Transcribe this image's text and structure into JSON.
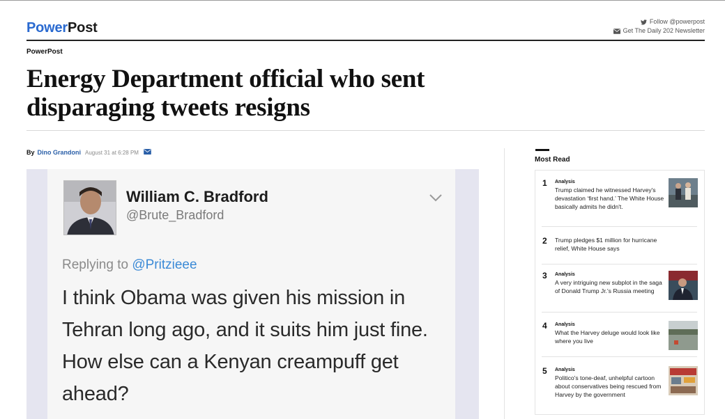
{
  "header": {
    "brand_part1": "Power",
    "brand_part2": "Post",
    "follow_label": "Follow @powerpost",
    "newsletter_label": "Get The Daily 202 Newsletter"
  },
  "kicker": "PowerPost",
  "headline": "Energy Department official who sent disparaging tweets resigns",
  "byline": {
    "by": "By",
    "author": "Dino Grandoni",
    "date": "August 31 at 6:28 PM"
  },
  "tweet": {
    "name": "William C. Bradford",
    "handle": "@Brute_Bradford",
    "replying_prefix": "Replying to ",
    "replying_to": "@Pritzieee",
    "text": "I think Obama was given his mission in Tehran long ago, and it suits him just fine. How else can a Kenyan creampuff get ahead?"
  },
  "most_read": {
    "title": "Most Read",
    "items": [
      {
        "num": "1",
        "kicker": "Analysis",
        "title": "Trump claimed he witnessed Harvey's devastation ‘first hand.’ The White House basically admits he didn't."
      },
      {
        "num": "2",
        "kicker": "",
        "title": "Trump pledges $1 million for hurricane relief, White House says"
      },
      {
        "num": "3",
        "kicker": "Analysis",
        "title": "A very intriguing new subplot in the saga of Donald Trump Jr.'s Russia meeting"
      },
      {
        "num": "4",
        "kicker": "Analysis",
        "title": "What the Harvey deluge would look like where you live"
      },
      {
        "num": "5",
        "kicker": "Analysis",
        "title": "Politico's tone-deaf, unhelpful cartoon about conservatives being rescued from Harvey by the government"
      }
    ]
  },
  "colors": {
    "brand_blue": "#2a6ad0",
    "link_blue": "#2a5fa8",
    "mention_blue": "#3b8ad6",
    "tweet_frame": "#e5e5f0"
  },
  "icons": {
    "twitter": "twitter-bird-icon",
    "email": "envelope-icon",
    "tweet_menu": "chevron-down-icon"
  }
}
